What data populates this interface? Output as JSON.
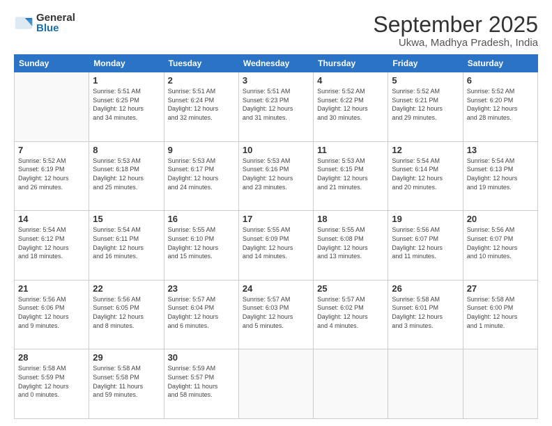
{
  "header": {
    "logo_general": "General",
    "logo_blue": "Blue",
    "month_title": "September 2025",
    "location": "Ukwa, Madhya Pradesh, India"
  },
  "weekdays": [
    "Sunday",
    "Monday",
    "Tuesday",
    "Wednesday",
    "Thursday",
    "Friday",
    "Saturday"
  ],
  "weeks": [
    [
      {
        "day": "",
        "info": ""
      },
      {
        "day": "1",
        "info": "Sunrise: 5:51 AM\nSunset: 6:25 PM\nDaylight: 12 hours\nand 34 minutes."
      },
      {
        "day": "2",
        "info": "Sunrise: 5:51 AM\nSunset: 6:24 PM\nDaylight: 12 hours\nand 32 minutes."
      },
      {
        "day": "3",
        "info": "Sunrise: 5:51 AM\nSunset: 6:23 PM\nDaylight: 12 hours\nand 31 minutes."
      },
      {
        "day": "4",
        "info": "Sunrise: 5:52 AM\nSunset: 6:22 PM\nDaylight: 12 hours\nand 30 minutes."
      },
      {
        "day": "5",
        "info": "Sunrise: 5:52 AM\nSunset: 6:21 PM\nDaylight: 12 hours\nand 29 minutes."
      },
      {
        "day": "6",
        "info": "Sunrise: 5:52 AM\nSunset: 6:20 PM\nDaylight: 12 hours\nand 28 minutes."
      }
    ],
    [
      {
        "day": "7",
        "info": "Sunrise: 5:52 AM\nSunset: 6:19 PM\nDaylight: 12 hours\nand 26 minutes."
      },
      {
        "day": "8",
        "info": "Sunrise: 5:53 AM\nSunset: 6:18 PM\nDaylight: 12 hours\nand 25 minutes."
      },
      {
        "day": "9",
        "info": "Sunrise: 5:53 AM\nSunset: 6:17 PM\nDaylight: 12 hours\nand 24 minutes."
      },
      {
        "day": "10",
        "info": "Sunrise: 5:53 AM\nSunset: 6:16 PM\nDaylight: 12 hours\nand 23 minutes."
      },
      {
        "day": "11",
        "info": "Sunrise: 5:53 AM\nSunset: 6:15 PM\nDaylight: 12 hours\nand 21 minutes."
      },
      {
        "day": "12",
        "info": "Sunrise: 5:54 AM\nSunset: 6:14 PM\nDaylight: 12 hours\nand 20 minutes."
      },
      {
        "day": "13",
        "info": "Sunrise: 5:54 AM\nSunset: 6:13 PM\nDaylight: 12 hours\nand 19 minutes."
      }
    ],
    [
      {
        "day": "14",
        "info": "Sunrise: 5:54 AM\nSunset: 6:12 PM\nDaylight: 12 hours\nand 18 minutes."
      },
      {
        "day": "15",
        "info": "Sunrise: 5:54 AM\nSunset: 6:11 PM\nDaylight: 12 hours\nand 16 minutes."
      },
      {
        "day": "16",
        "info": "Sunrise: 5:55 AM\nSunset: 6:10 PM\nDaylight: 12 hours\nand 15 minutes."
      },
      {
        "day": "17",
        "info": "Sunrise: 5:55 AM\nSunset: 6:09 PM\nDaylight: 12 hours\nand 14 minutes."
      },
      {
        "day": "18",
        "info": "Sunrise: 5:55 AM\nSunset: 6:08 PM\nDaylight: 12 hours\nand 13 minutes."
      },
      {
        "day": "19",
        "info": "Sunrise: 5:56 AM\nSunset: 6:07 PM\nDaylight: 12 hours\nand 11 minutes."
      },
      {
        "day": "20",
        "info": "Sunrise: 5:56 AM\nSunset: 6:07 PM\nDaylight: 12 hours\nand 10 minutes."
      }
    ],
    [
      {
        "day": "21",
        "info": "Sunrise: 5:56 AM\nSunset: 6:06 PM\nDaylight: 12 hours\nand 9 minutes."
      },
      {
        "day": "22",
        "info": "Sunrise: 5:56 AM\nSunset: 6:05 PM\nDaylight: 12 hours\nand 8 minutes."
      },
      {
        "day": "23",
        "info": "Sunrise: 5:57 AM\nSunset: 6:04 PM\nDaylight: 12 hours\nand 6 minutes."
      },
      {
        "day": "24",
        "info": "Sunrise: 5:57 AM\nSunset: 6:03 PM\nDaylight: 12 hours\nand 5 minutes."
      },
      {
        "day": "25",
        "info": "Sunrise: 5:57 AM\nSunset: 6:02 PM\nDaylight: 12 hours\nand 4 minutes."
      },
      {
        "day": "26",
        "info": "Sunrise: 5:58 AM\nSunset: 6:01 PM\nDaylight: 12 hours\nand 3 minutes."
      },
      {
        "day": "27",
        "info": "Sunrise: 5:58 AM\nSunset: 6:00 PM\nDaylight: 12 hours\nand 1 minute."
      }
    ],
    [
      {
        "day": "28",
        "info": "Sunrise: 5:58 AM\nSunset: 5:59 PM\nDaylight: 12 hours\nand 0 minutes."
      },
      {
        "day": "29",
        "info": "Sunrise: 5:58 AM\nSunset: 5:58 PM\nDaylight: 11 hours\nand 59 minutes."
      },
      {
        "day": "30",
        "info": "Sunrise: 5:59 AM\nSunset: 5:57 PM\nDaylight: 11 hours\nand 58 minutes."
      },
      {
        "day": "",
        "info": ""
      },
      {
        "day": "",
        "info": ""
      },
      {
        "day": "",
        "info": ""
      },
      {
        "day": "",
        "info": ""
      }
    ]
  ]
}
